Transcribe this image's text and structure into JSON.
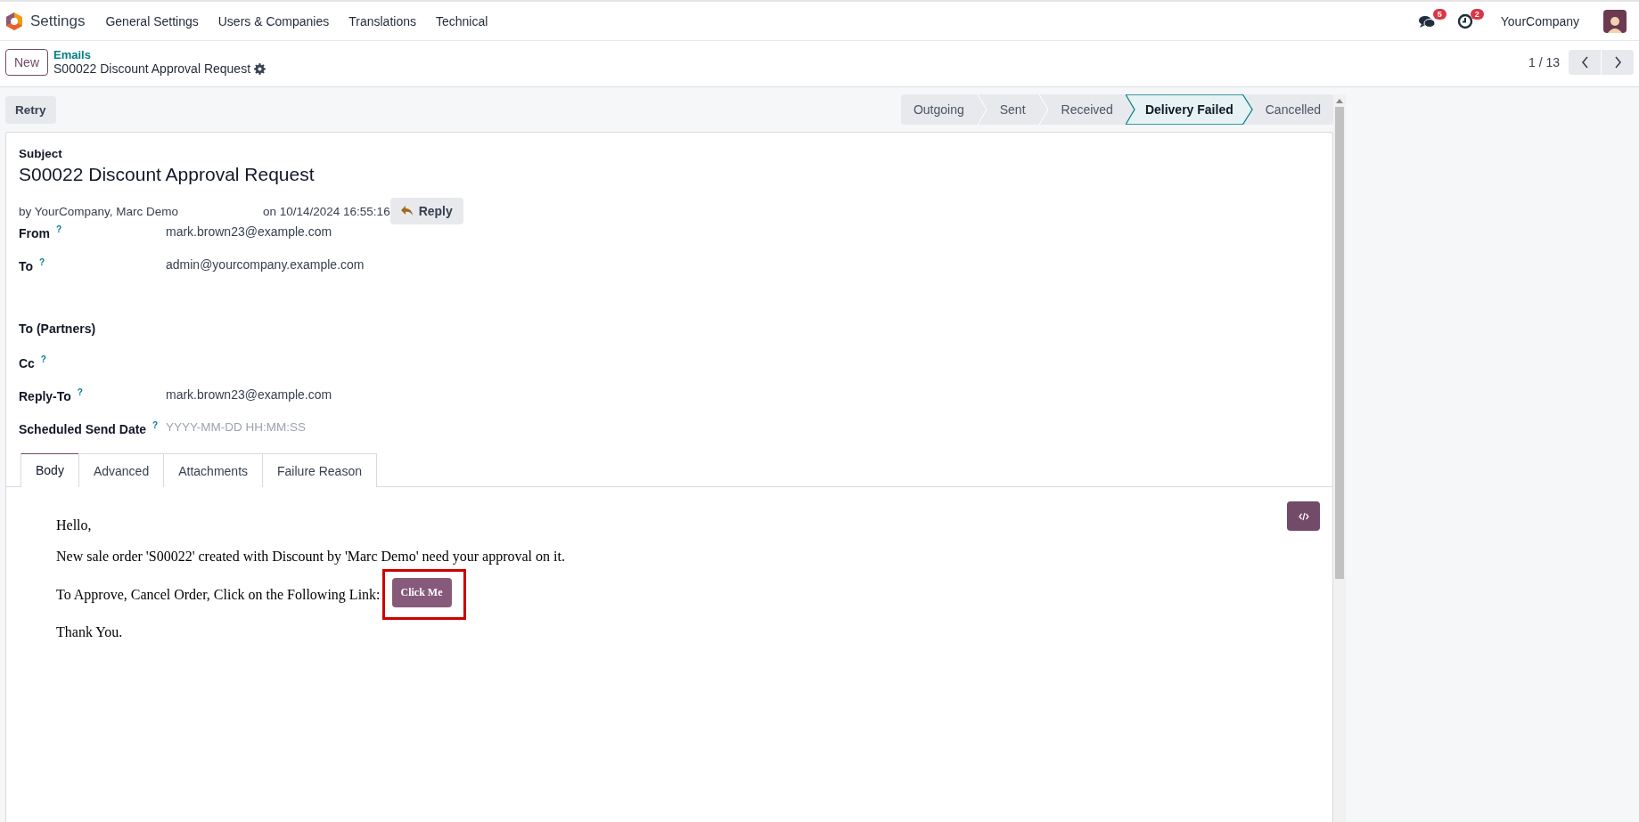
{
  "navbar": {
    "app_name": "Settings",
    "menu": [
      "General Settings",
      "Users & Companies",
      "Translations",
      "Technical"
    ],
    "messages_count": "5",
    "activities_count": "2",
    "company": "YourCompany"
  },
  "control_panel": {
    "new_button": "New",
    "breadcrumb": "Emails",
    "record_title": "S00022 Discount Approval Request",
    "pager": "1 / 13"
  },
  "retry_button": "Retry",
  "statusbar": [
    {
      "label": "Outgoing",
      "selected": false
    },
    {
      "label": "Sent",
      "selected": false
    },
    {
      "label": "Received",
      "selected": false
    },
    {
      "label": "Delivery Failed",
      "selected": true
    },
    {
      "label": "Cancelled",
      "selected": false
    }
  ],
  "form": {
    "subject_label": "Subject",
    "subject": "S00022 Discount Approval Request",
    "author": "by YourCompany, Marc Demo",
    "date": "on 10/14/2024 16:55:16",
    "reply_button": "Reply",
    "fields": [
      {
        "kind": "text",
        "label": "From",
        "help": "?",
        "value": "mark.brown23@example.com"
      },
      {
        "kind": "textarea",
        "label": "To",
        "help": "?",
        "value": "admin@yourcompany.example.com"
      },
      {
        "kind": "text",
        "label": "To (Partners)"
      },
      {
        "kind": "text",
        "label": "Cc",
        "help": "?"
      },
      {
        "kind": "text",
        "label": "Reply-To",
        "help": "?",
        "value": "mark.brown23@example.com"
      },
      {
        "kind": "text",
        "label": "Scheduled Send Date",
        "help": "?",
        "placeholder": "YYYY-MM-DD HH:MM:SS"
      }
    ]
  },
  "tabs": [
    {
      "label": "Body",
      "selected": true
    },
    {
      "label": "Advanced",
      "selected": false
    },
    {
      "label": "Attachments",
      "selected": false
    },
    {
      "label": "Failure Reason",
      "selected": false
    }
  ],
  "body": {
    "greeting": "Hello,",
    "message": "New sale order 'S00022' created with Discount by 'Marc Demo' need your approval on it.",
    "link_intro": "To Approve, Cancel Order, Click on the Following Link:",
    "link_button": "Click Me",
    "link_highlighted": true,
    "closing": "Thank You."
  }
}
